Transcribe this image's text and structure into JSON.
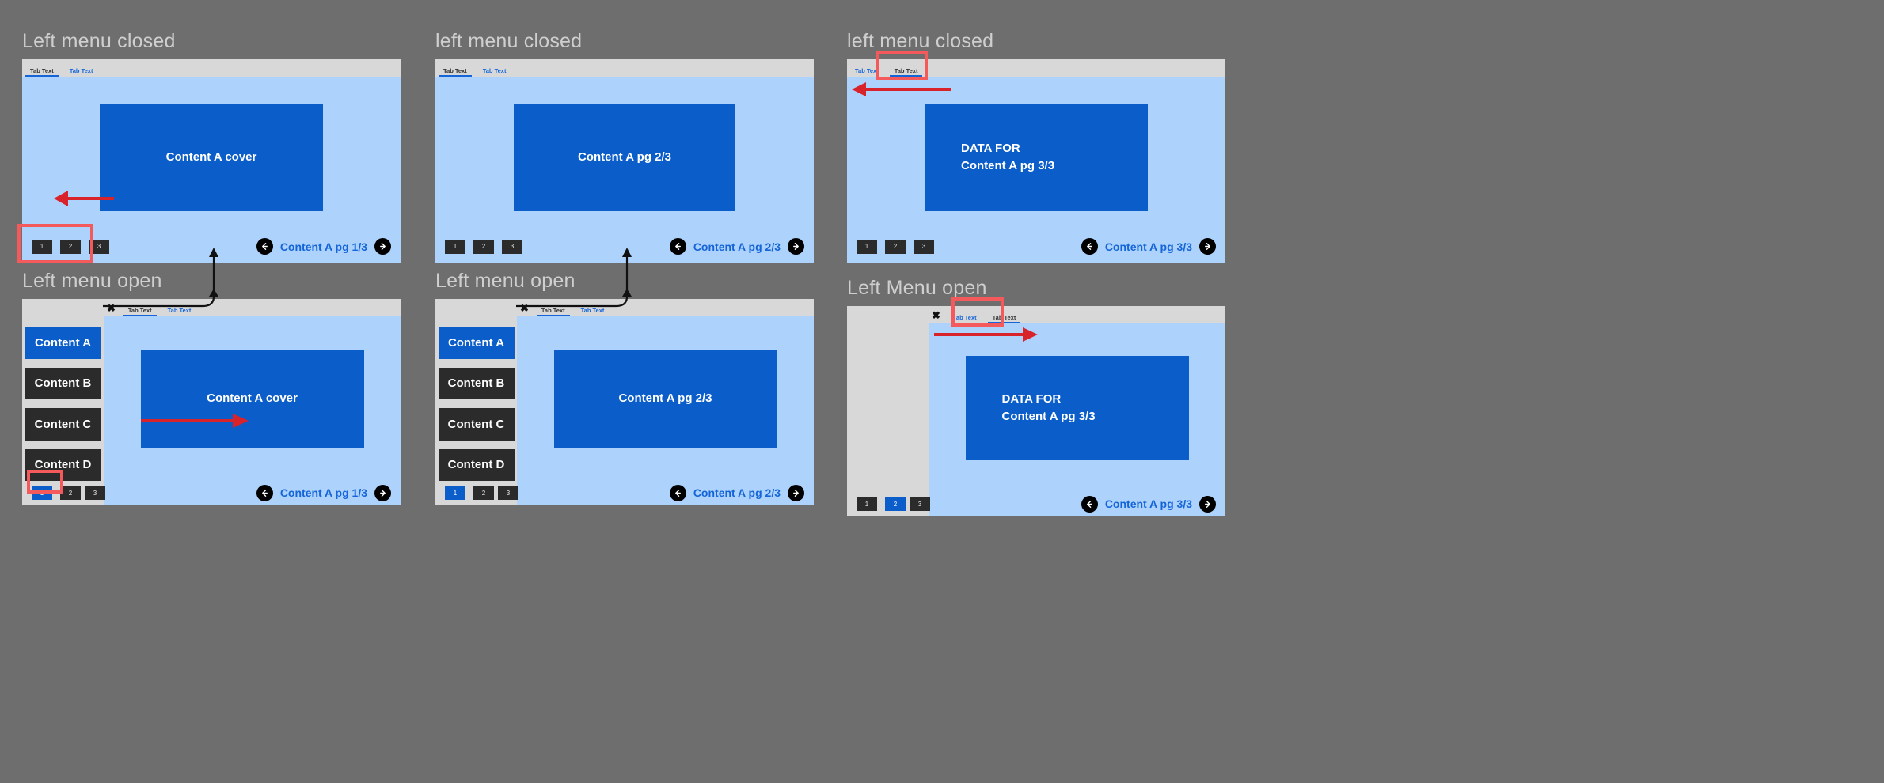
{
  "app": {
    "brand_blue": "#0b5ec9",
    "tab_blue": "#1565d8",
    "stage_blue": "#ADD3FD",
    "chrome_gray": "#d8d8d8",
    "dark_btn": "#2b2b2b",
    "page_bg": "#6e6e6e",
    "annotation_red": "#f4595b",
    "arrow_red": "#d8232a"
  },
  "tabs": {
    "tab1_label": "Tab Text",
    "tab2_label": "Tab Text",
    "close_glyph": "✖"
  },
  "sidebar": {
    "items": [
      {
        "label": "Content A"
      },
      {
        "label": "Content B"
      },
      {
        "label": "Content C"
      },
      {
        "label": "Content D"
      }
    ]
  },
  "pager": {
    "buttons": [
      "1",
      "2",
      "3"
    ]
  },
  "panels": [
    {
      "id": "p1",
      "title": "Left menu closed",
      "menu_open": false,
      "active_tab": 0,
      "cover_text": "Content A cover",
      "nav_label": "Content A pg  1/3",
      "active_page": null,
      "highlight": "pager"
    },
    {
      "id": "p2",
      "title": "left menu closed",
      "menu_open": false,
      "active_tab": 0,
      "cover_text": "Content A pg  2/3",
      "nav_label": "Content A pg  2/3",
      "active_page": null,
      "highlight": null
    },
    {
      "id": "p3",
      "title": "left menu closed",
      "menu_open": false,
      "active_tab": 1,
      "cover_text": "DATA FOR\nContent A pg  3/3",
      "nav_label": "Content A pg  3/3",
      "active_page": null,
      "highlight": "tab2"
    },
    {
      "id": "p4",
      "title": "Left menu open",
      "menu_open": true,
      "sidebar_visible": true,
      "active_tab": 0,
      "cover_text": "Content A cover",
      "nav_label": "Content A pg  1/3",
      "active_page": 0,
      "highlight": "pager-first"
    },
    {
      "id": "p5",
      "title": "Left menu open",
      "menu_open": true,
      "sidebar_visible": true,
      "active_tab": 0,
      "cover_text": "Content A pg  2/3",
      "nav_label": "Content A pg  2/3",
      "active_page": 0,
      "highlight": null
    },
    {
      "id": "p6",
      "title": "Left Menu open",
      "menu_open": true,
      "sidebar_visible": false,
      "active_tab": 1,
      "cover_text": "DATA FOR\nContent A pg  3/3",
      "nav_label": "Content A pg  3/3",
      "active_page": 1,
      "highlight": "tab2"
    }
  ]
}
